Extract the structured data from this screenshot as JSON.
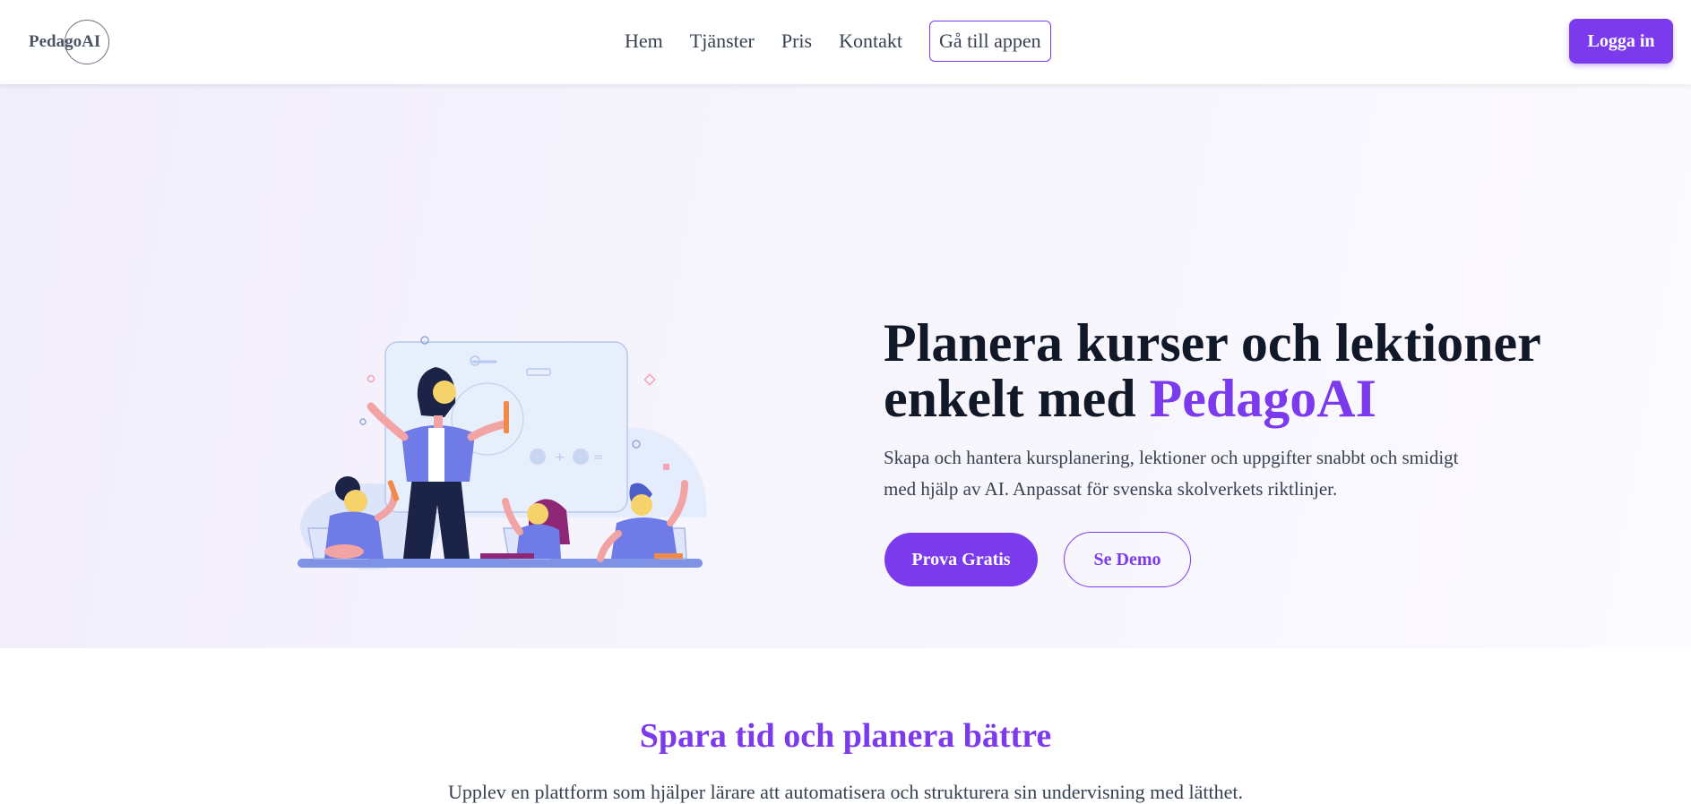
{
  "header": {
    "logo_text": "PedagoAI",
    "nav": [
      {
        "label": "Hem"
      },
      {
        "label": "Tjänster"
      },
      {
        "label": "Pris"
      },
      {
        "label": "Kontakt"
      }
    ],
    "app_button": "Gå till appen",
    "login_button": "Logga in"
  },
  "hero": {
    "title_line1": "Planera kurser och lektioner",
    "title_line2_prefix": "enkelt med ",
    "title_accent": "PedagoAI",
    "subtitle": "Skapa och hantera kursplanering, lektioner och uppgifter snabbt och smidigt med hjälp av AI. Anpassat för svenska skolverkets riktlinjer.",
    "primary_button": "Prova Gratis",
    "secondary_button": "Se Demo",
    "illustration_icon": "teacher-classroom-illustration"
  },
  "features": {
    "title": "Spara tid och planera bättre",
    "subtitle": "Upplev en plattform som hjälper lärare att automatisera och strukturera sin undervisning med lätthet."
  },
  "colors": {
    "accent": "#7c3aed",
    "text_dark": "#111827",
    "text_body": "#374151",
    "hero_bg": "#f3f1fb"
  }
}
